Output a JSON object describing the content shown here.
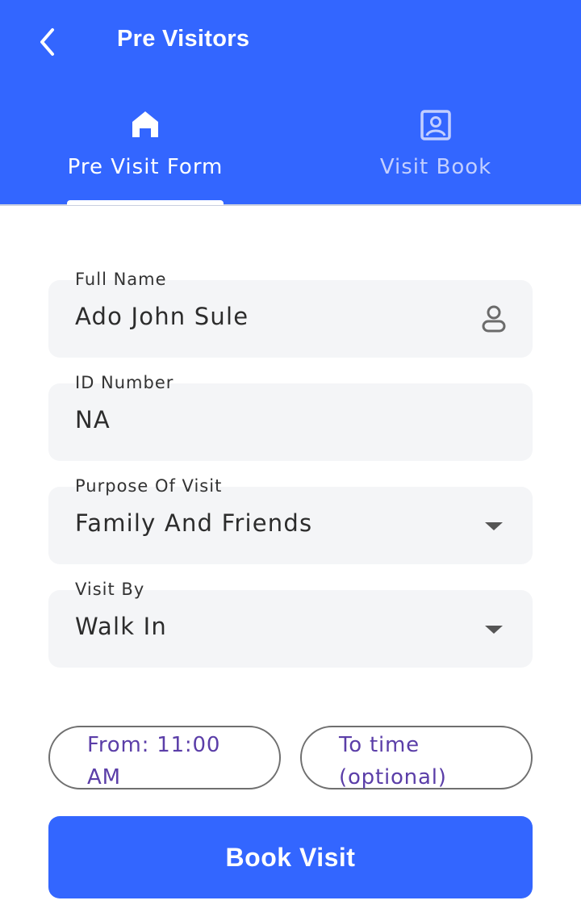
{
  "header": {
    "title": "Pre Visitors",
    "back_icon": "chevron-left-icon"
  },
  "tabs": [
    {
      "label": "Pre Visit Form",
      "icon": "home-icon",
      "active": true
    },
    {
      "label": "Visit Book",
      "icon": "contact-book-icon",
      "active": false
    }
  ],
  "form": {
    "full_name": {
      "label": "Full Name",
      "value": "Ado John Sule",
      "icon": "person-icon"
    },
    "id_number": {
      "label": "ID Number",
      "value": "NA"
    },
    "purpose": {
      "label": "Purpose Of Visit",
      "value": "Family And Friends"
    },
    "visit_by": {
      "label": "Visit By",
      "value": "Walk In"
    }
  },
  "time": {
    "from": "From: 11:00 AM",
    "to": "To time (optional)"
  },
  "actions": {
    "book_label": "Book Visit"
  },
  "colors": {
    "primary": "#3366ff",
    "field_bg": "#f4f5f7",
    "pill_text": "#5b3ea8"
  }
}
